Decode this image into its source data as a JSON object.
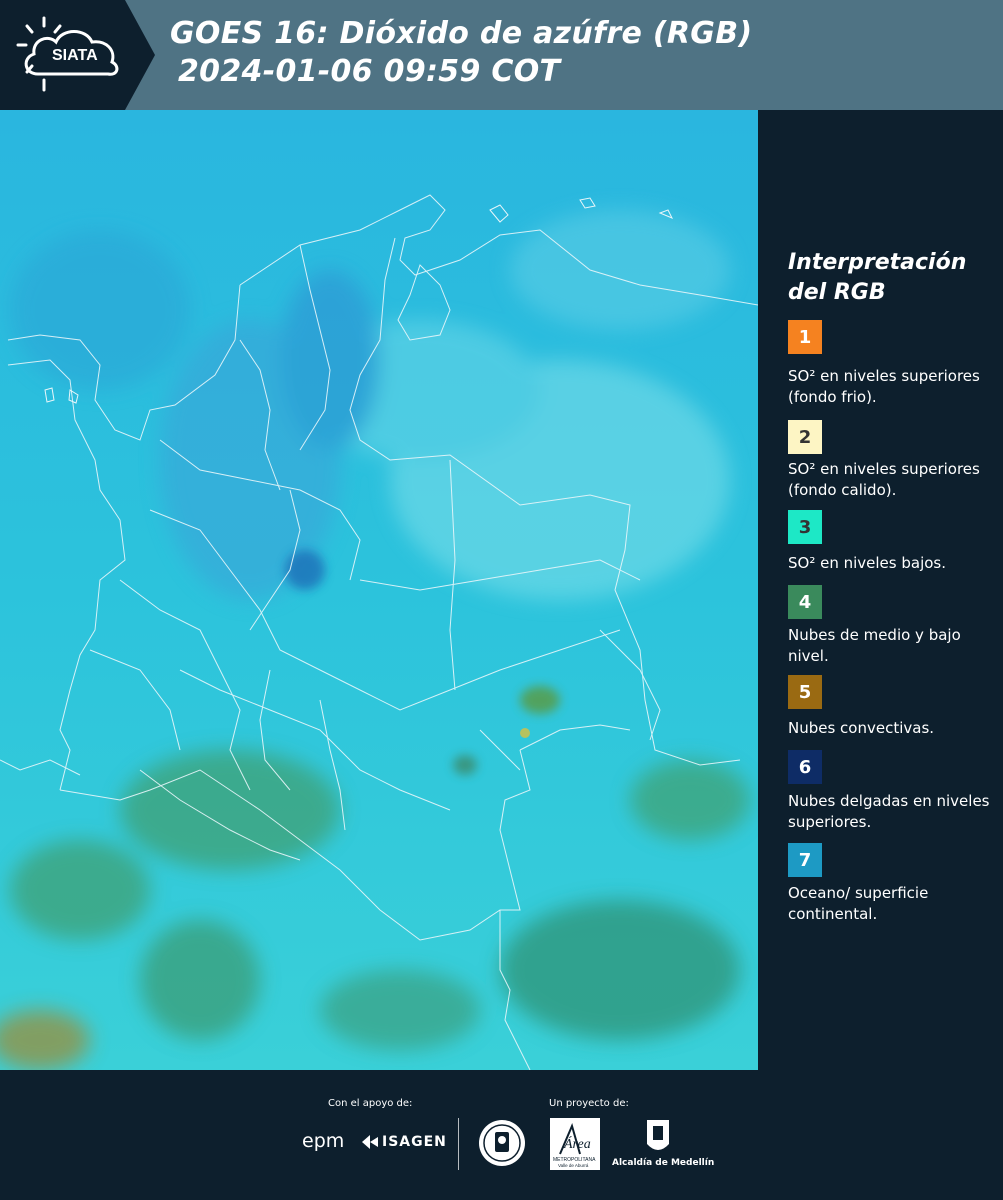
{
  "header": {
    "logo_text": "SIATA",
    "title_line1": "GOES 16: Dióxido de azúfre (RGB)",
    "title_line2": "2024-01-06 09:59 COT"
  },
  "legend": {
    "title_line1": "Interpretación",
    "title_line2": "del RGB",
    "items": [
      {
        "number": "1",
        "color": "#f58220",
        "text": "SO² en niveles superiores (fondo frio)."
      },
      {
        "number": "2",
        "color": "#fdf5c4",
        "text": "SO² en niveles superiores (fondo calido)."
      },
      {
        "number": "3",
        "color": "#1de8c6",
        "text": "SO² en niveles bajos."
      },
      {
        "number": "4",
        "color": "#3a8a5c",
        "text": "Nubes de medio y bajo nivel."
      },
      {
        "number": "5",
        "color": "#9a6a12",
        "text": "Nubes convectivas."
      },
      {
        "number": "6",
        "color": "#0e2c66",
        "text": "Nubes delgadas en niveles superiores."
      },
      {
        "number": "7",
        "color": "#1d9ac4",
        "text": "Oceano/ superficie continental."
      }
    ]
  },
  "footer": {
    "support_label": "Con el apoyo de:",
    "project_label": "Un proyecto de:",
    "sponsor_epm": "epm",
    "sponsor_isagen": "ISAGEN",
    "area_name": "Área",
    "area_sub": "METROPOLITANA",
    "area_sub2": "Valle de Aburrá",
    "alcaldia": "Alcaldía de Medellín"
  }
}
